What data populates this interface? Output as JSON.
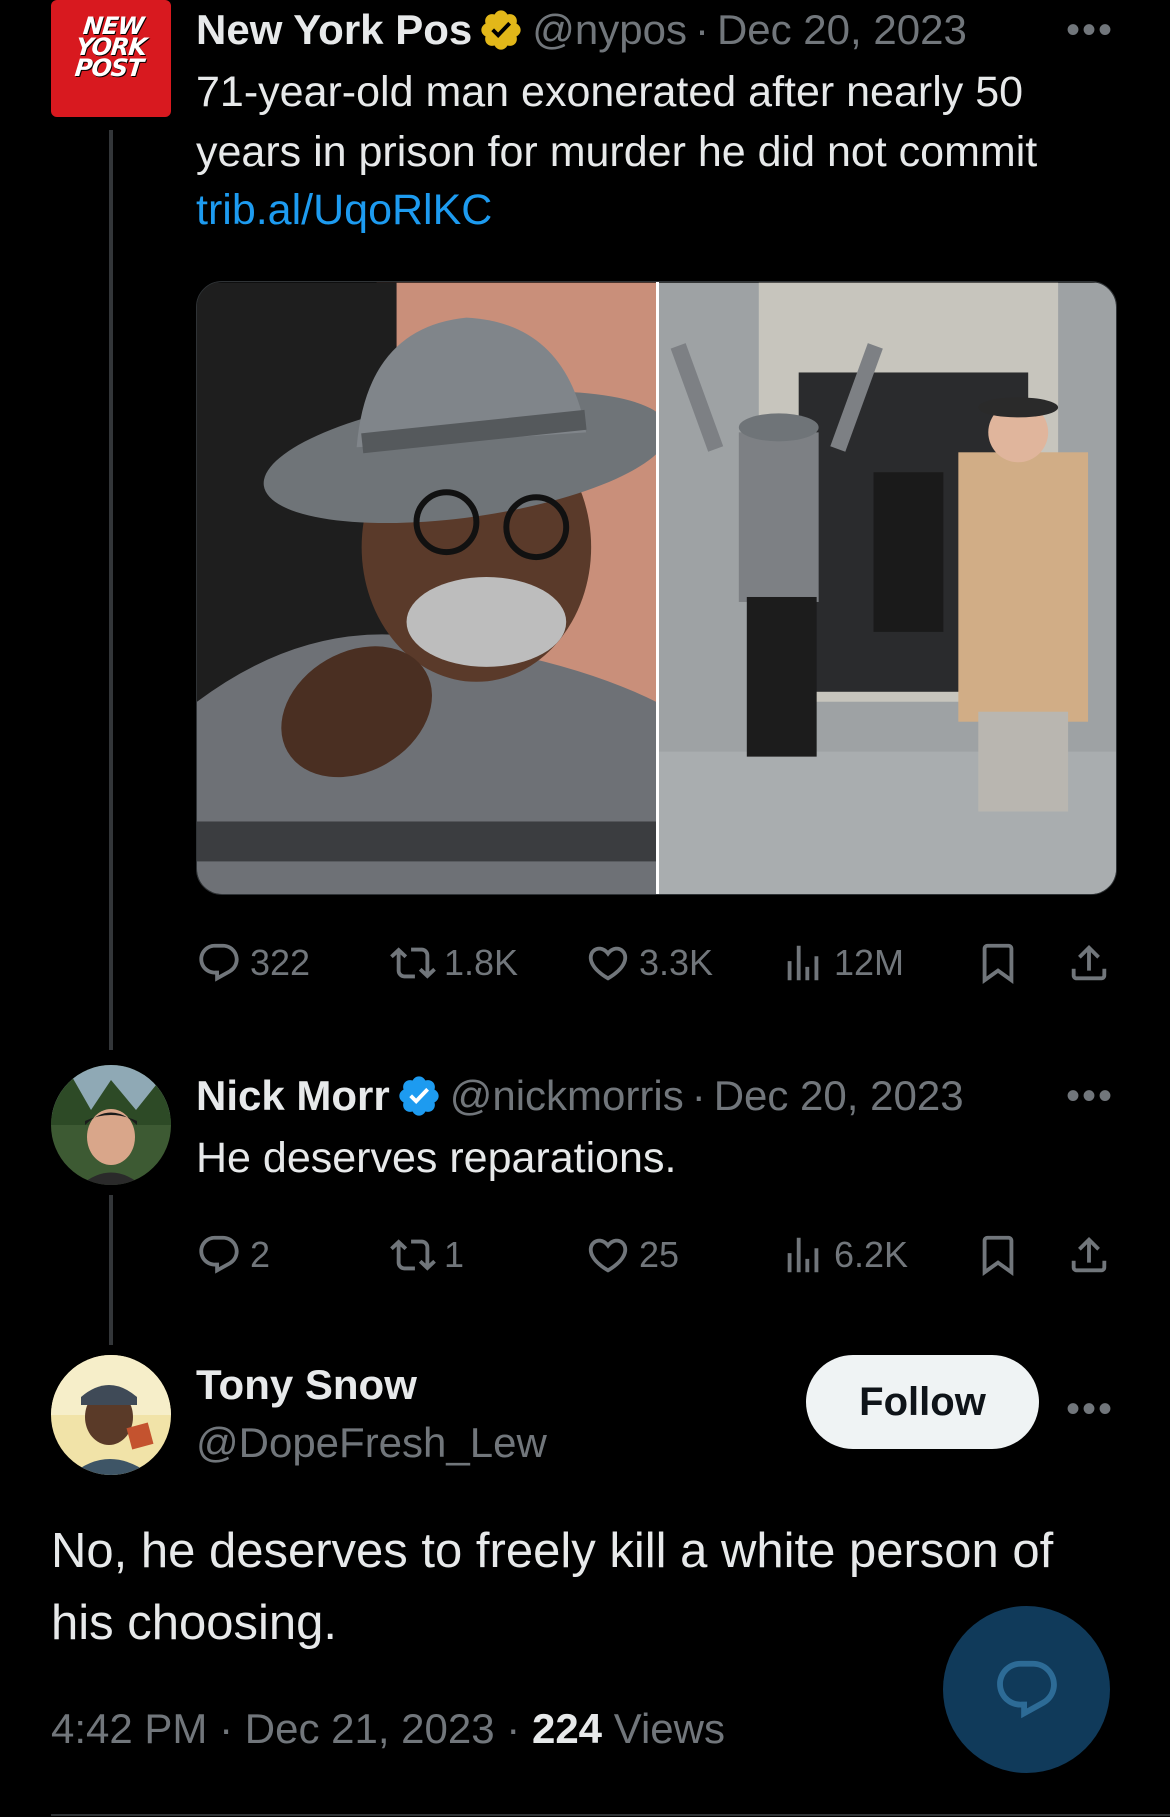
{
  "tweets": [
    {
      "name": "New York Pos",
      "handle": "@nypos",
      "separator": "·",
      "date": "Dec 20, 2023",
      "verified": "gold",
      "avatar_logo_text": "NEW YORK POST",
      "text": "71-year-old man exonerated after nearly 50 years in prison for murder he did not commit",
      "link": "trib.al/UqoRlKC",
      "stats": {
        "replies": "322",
        "reposts": "1.8K",
        "likes": "3.3K",
        "views": "12M"
      }
    },
    {
      "name": "Nick Morr",
      "handle": "@nickmorris",
      "separator": "·",
      "date": "Dec 20, 2023",
      "verified": "blue",
      "text": "He deserves reparations.",
      "stats": {
        "replies": "2",
        "reposts": "1",
        "likes": "25",
        "views": "6.2K"
      }
    }
  ],
  "focused": {
    "name": "Tony Snow",
    "handle": "@DopeFresh_Lew",
    "follow_label": "Follow",
    "text": "No, he deserves to freely kill a white person of his choosing.",
    "time": "4:42 PM",
    "separator": "·",
    "date": "Dec 21, 2023",
    "views_count": "224",
    "views_label": "Views"
  },
  "more_glyph": "•••",
  "colors": {
    "background": "#000000",
    "link": "#1d9bf0",
    "muted": "#71767b",
    "gold_badge": "#e2b719",
    "blue_badge": "#1d9bf0",
    "fab": "#103a5a"
  },
  "icons": [
    "reply-icon",
    "repost-icon",
    "like-icon",
    "views-icon",
    "bookmark-icon",
    "share-icon",
    "verified-badge-icon",
    "compose-reply-icon"
  ]
}
